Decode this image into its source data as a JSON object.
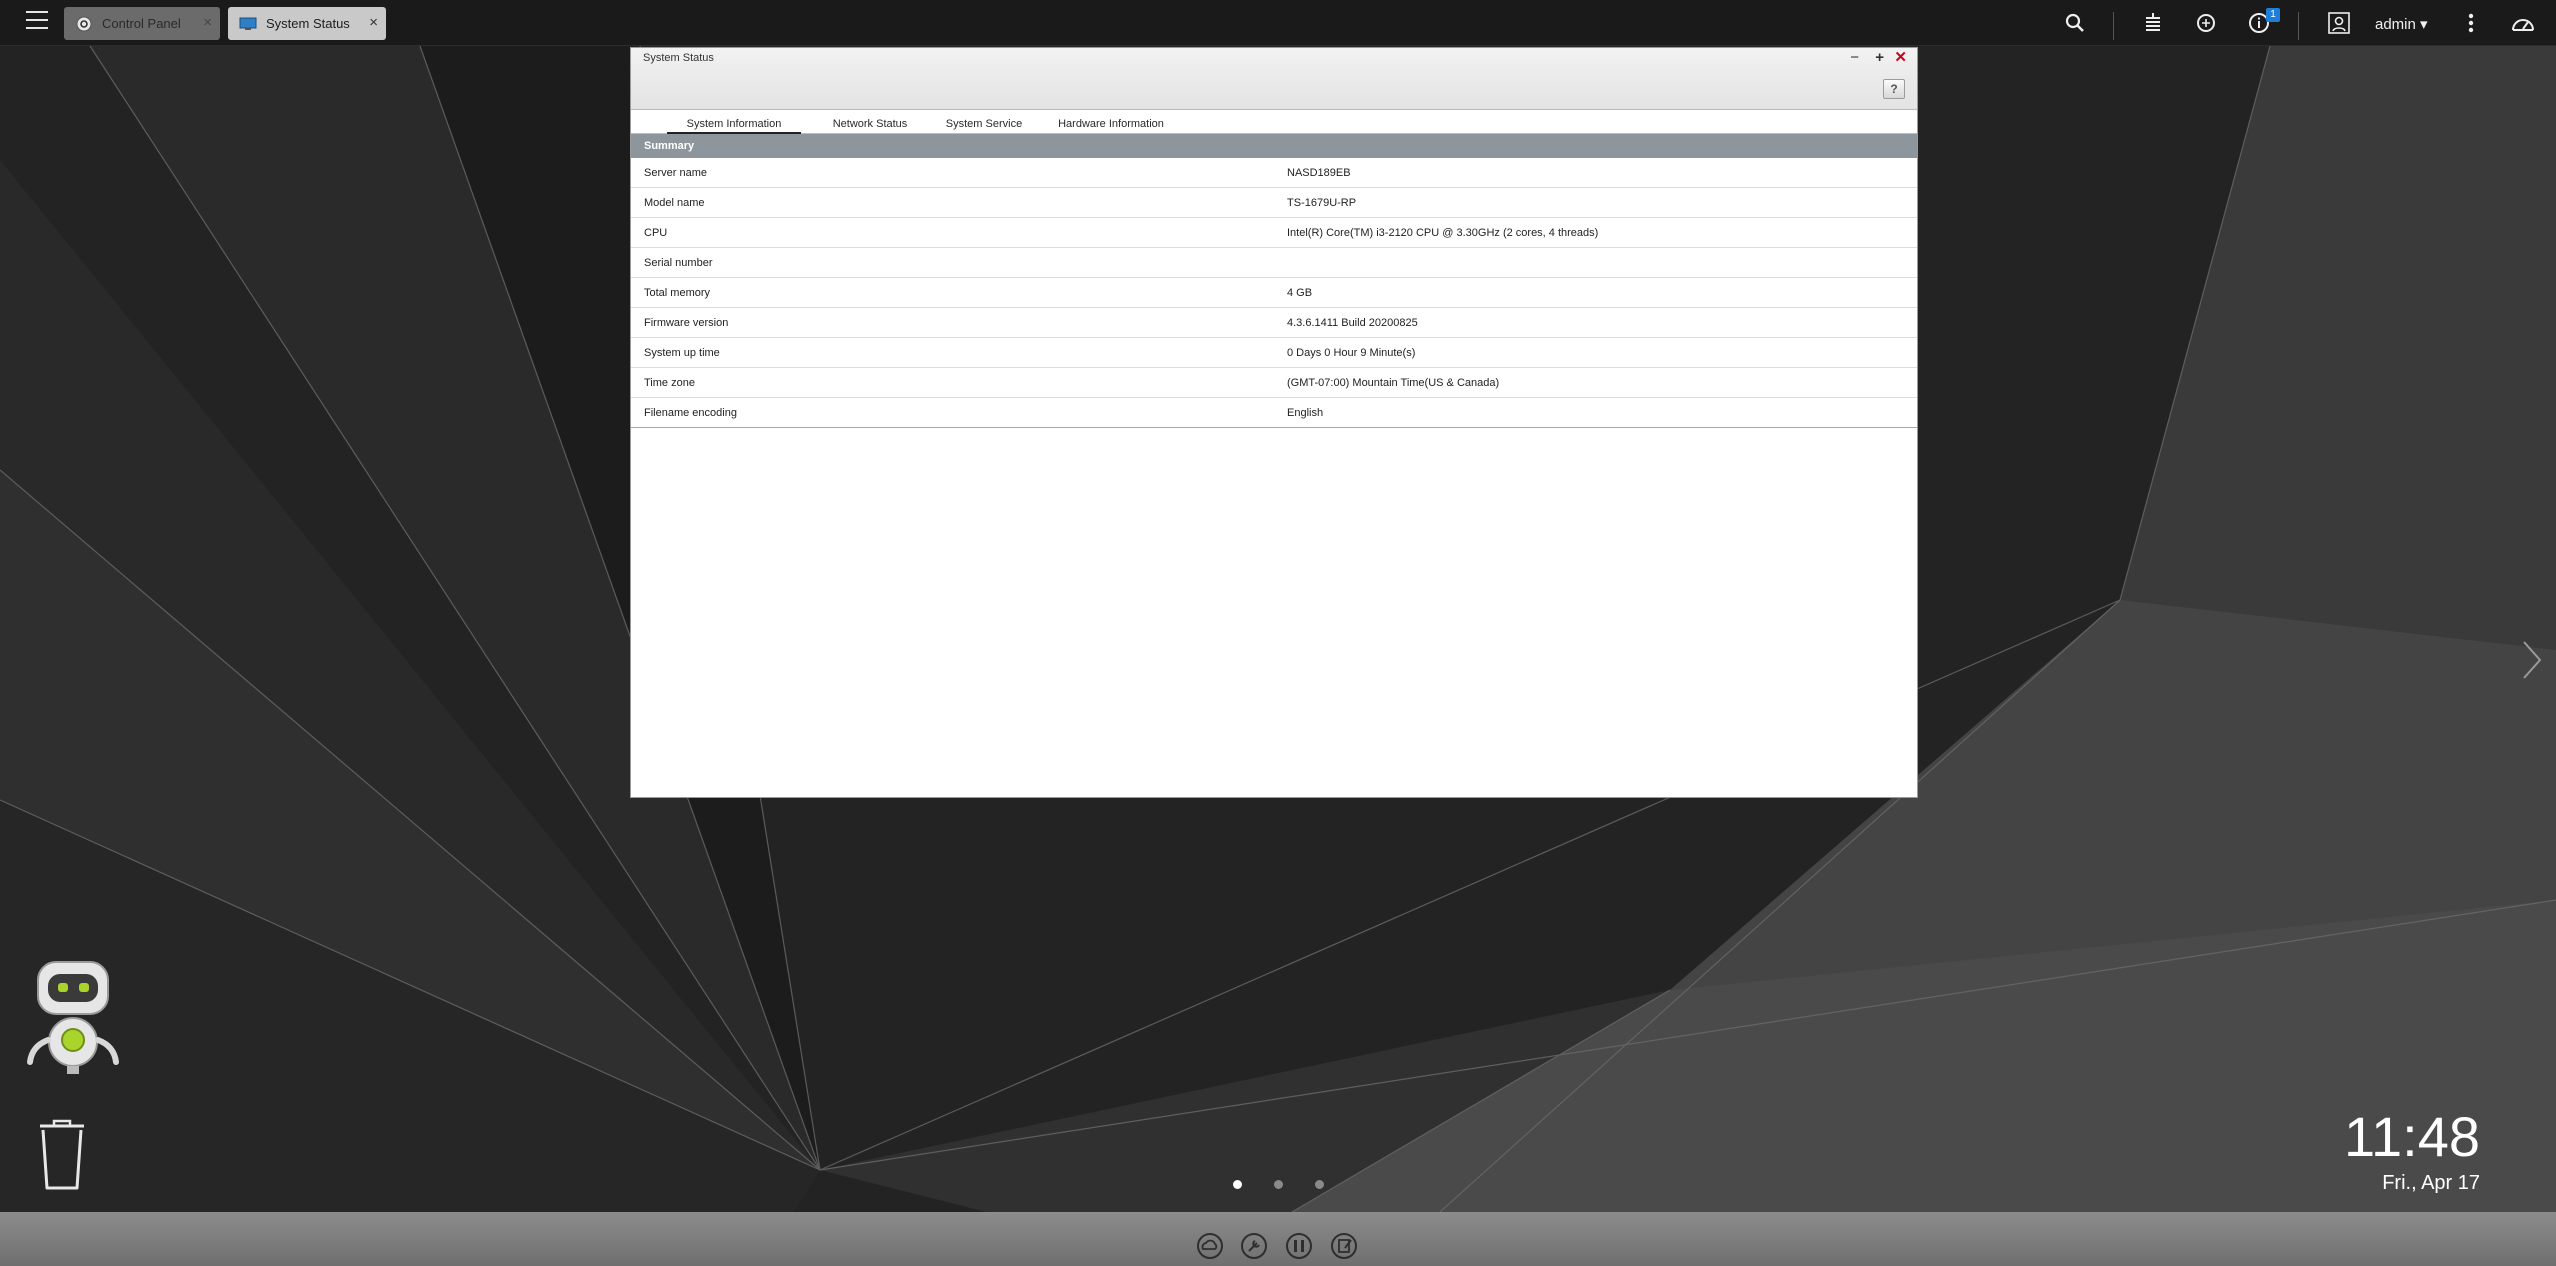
{
  "tasks": [
    {
      "label": "Control Panel",
      "close": "×"
    },
    {
      "label": "System Status",
      "close": "×"
    }
  ],
  "topbar": {
    "user": "admin ▾",
    "notification_count": "1"
  },
  "window": {
    "title": "System Status",
    "controls": {
      "minimize": "−",
      "maximize": "+",
      "close": "✕"
    },
    "help": "?",
    "tabs": [
      "System Information",
      "Network Status",
      "System Service",
      "Hardware Information"
    ],
    "active_tab": "System Information",
    "section": "Summary",
    "rows": [
      {
        "key": "Server name",
        "value": "NASD189EB"
      },
      {
        "key": "Model name",
        "value": "TS-1679U-RP"
      },
      {
        "key": "CPU",
        "value": "Intel(R) Core(TM) i3-2120 CPU @ 3.30GHz (2 cores, 4 threads)"
      },
      {
        "key": "Serial number",
        "value": ""
      },
      {
        "key": "Total memory",
        "value": "4 GB"
      },
      {
        "key": "Firmware version",
        "value": "4.3.6.1411 Build 20200825"
      },
      {
        "key": "System up time",
        "value": "0 Days 0 Hour 9 Minute(s)"
      },
      {
        "key": "Time zone",
        "value": "(GMT-07:00) Mountain Time(US & Canada)"
      },
      {
        "key": "Filename encoding",
        "value": "English"
      }
    ]
  },
  "desktop": {
    "time": "11:48",
    "date": "Fri., Apr 17",
    "pages": 3,
    "active_page": 1
  },
  "colors": {
    "accent": "#1d7fd9",
    "close_red": "#d0021b",
    "summary_bar": "#8e969d",
    "robot_green": "#a8d42b"
  },
  "icons": [
    "menu-icon",
    "gear-icon",
    "monitor-icon",
    "search-icon",
    "stack-icon",
    "sync-icon",
    "info-icon",
    "user-icon",
    "more-icon",
    "dashboard-icon",
    "robot-icon",
    "trash-icon",
    "chevron-right-icon",
    "myqnapcloud-icon",
    "tools-icon",
    "pause-icon",
    "notes-icon"
  ]
}
